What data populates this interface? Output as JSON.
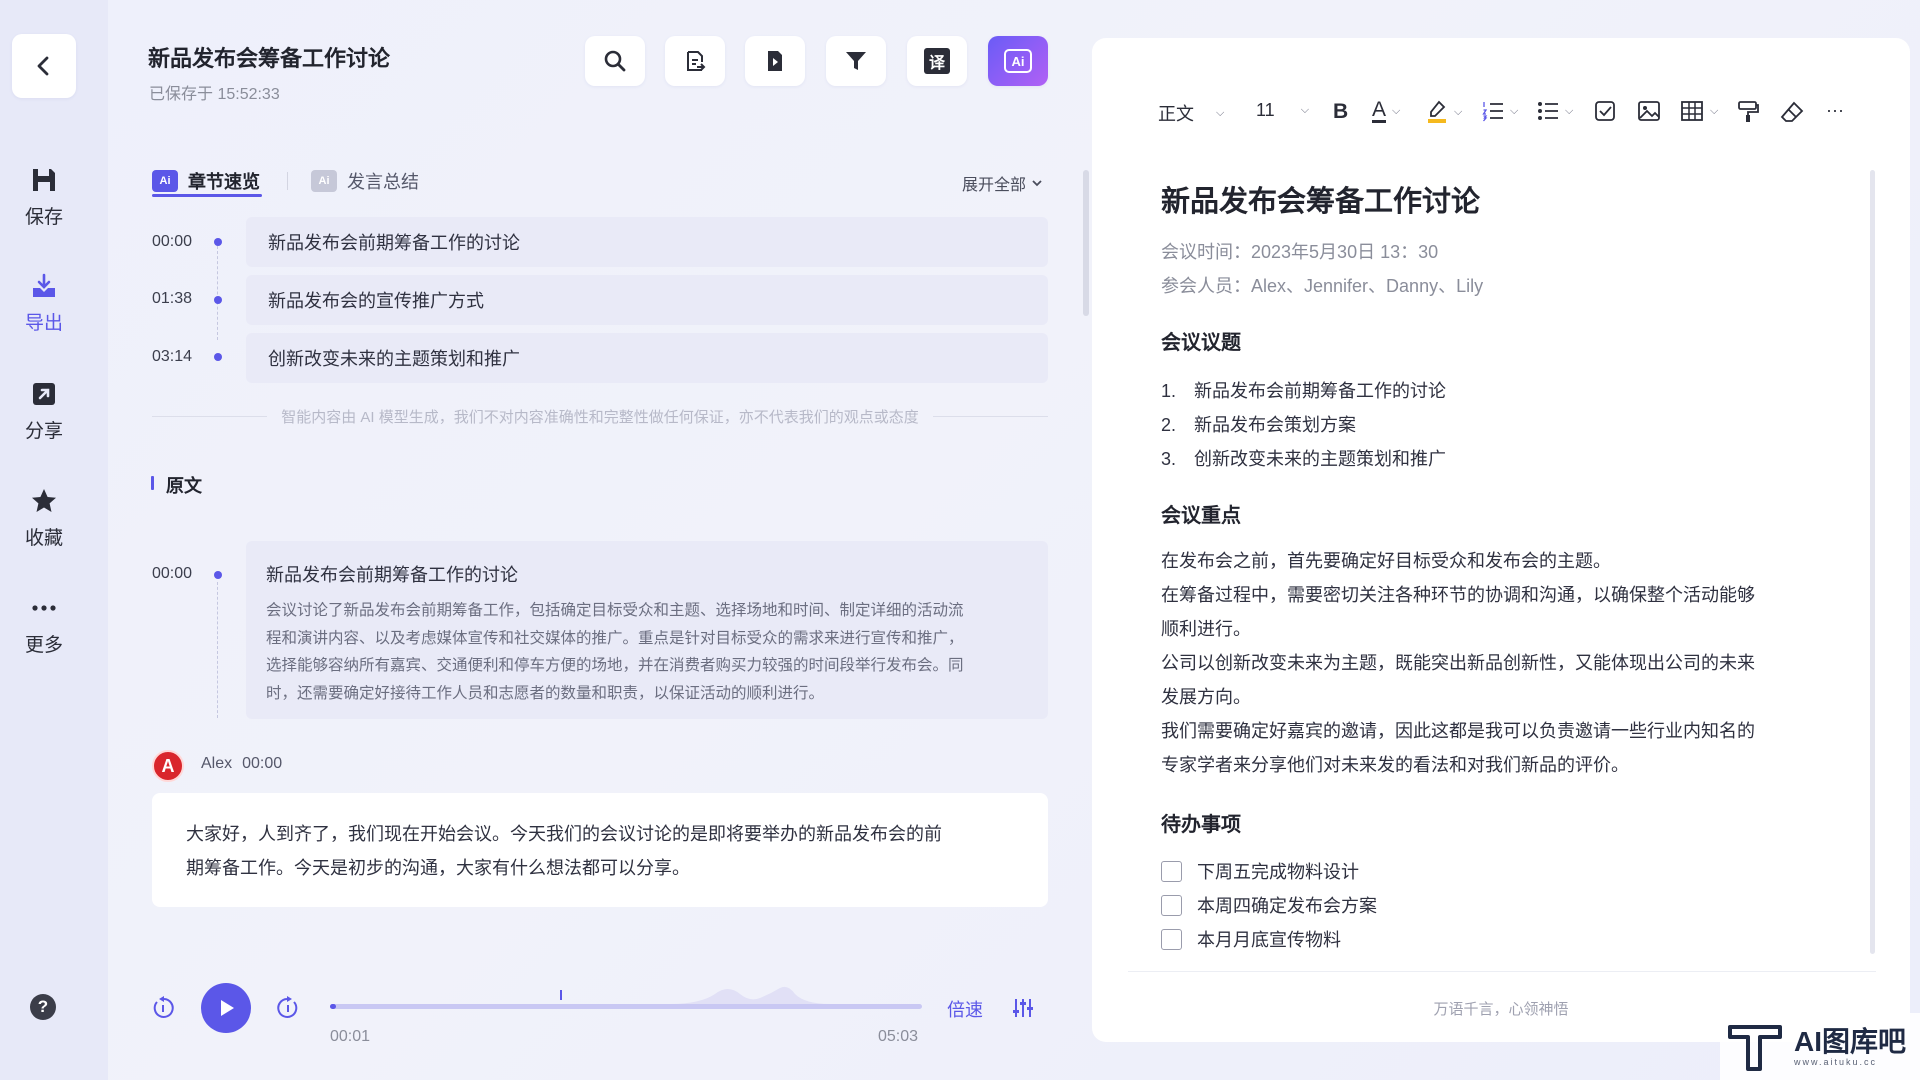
{
  "sidebar": {
    "items": [
      {
        "label": "保存",
        "icon": "save-icon"
      },
      {
        "label": "导出",
        "icon": "export-icon"
      },
      {
        "label": "分享",
        "icon": "share-icon"
      },
      {
        "label": "收藏",
        "icon": "star-icon"
      },
      {
        "label": "更多",
        "icon": "more-icon"
      }
    ],
    "help_label": "?"
  },
  "header": {
    "title": "新品发布会筹备工作讨论",
    "saved": "已保存于 15:52:33",
    "translate_label": "译",
    "ai_label": "Ai"
  },
  "tabs": {
    "chapters": "章节速览",
    "summary": "发言总结",
    "expand": "展开全部",
    "ai_badge": "Ai"
  },
  "chapters": [
    {
      "time": "00:00",
      "title": "新品发布会前期筹备工作的讨论"
    },
    {
      "time": "01:38",
      "title": "新品发布会的宣传推广方式"
    },
    {
      "time": "03:14",
      "title": "创新改变未来的主题策划和推广"
    }
  ],
  "disclaimer": "智能内容由 AI 模型生成，我们不对内容准确性和完整性做任何保证，亦不代表我们的观点或态度",
  "original": {
    "heading": "原文",
    "section": {
      "time": "00:00",
      "title": "新品发布会前期筹备工作的讨论",
      "lines": [
        "会议讨论了新品发布会前期筹备工作，包括确定目标受众和主题、选择场地和时间、制定详细的活动流",
        "程和演讲内容、以及考虑媒体宣传和社交媒体的推广。重点是针对目标受众的需求来进行宣传和推广，",
        "选择能够容纳所有嘉宾、交通便利和停车方便的场地，并在消费者购买力较强的时间段举行发布会。同",
        "时，还需要确定好接待工作人员和志愿者的数量和职责，以保证活动的顺利进行。"
      ]
    },
    "speaker": {
      "initial": "A",
      "name": "Alex",
      "time": "00:00"
    },
    "speech_lines": [
      "大家好，人到齐了，我们现在开始会议。今天我们的会议讨论的是即将要举办的新品发布会的前",
      "期筹备工作。今天是初步的沟通，大家有什么想法都可以分享。"
    ]
  },
  "player": {
    "current": "00:01",
    "total": "05:03",
    "speed": "倍速",
    "progress": 0.003
  },
  "editor": {
    "toolbar": {
      "style": "正文",
      "size": "11",
      "bold": "B",
      "font_color": "A",
      "more": "···"
    },
    "title": "新品发布会筹备工作讨论",
    "meta": [
      "会议时间：2023年5月30日 13：30",
      "参会人员：Alex、Jennifer、Danny、Lily"
    ],
    "agenda_heading": "会议议题",
    "agenda": [
      {
        "n": "1.",
        "text": "新品发布会前期筹备工作的讨论"
      },
      {
        "n": "2.",
        "text": "新品发布会策划方案"
      },
      {
        "n": "3.",
        "text": "创新改变未来的主题策划和推广"
      }
    ],
    "keypoints_heading": "会议重点",
    "keypoints_lines": [
      "在发布会之前，首先要确定好目标受众和发布会的主题。",
      "在筹备过程中，需要密切关注各种环节的协调和沟通，以确保整个活动能够",
      "顺利进行。",
      "公司以创新改变未来为主题，既能突出新品创新性，又能体现出公司的未来",
      "发展方向。",
      "我们需要确定好嘉宾的邀请，因此这都是我可以负责邀请一些行业内知名的",
      "专家学者来分享他们对未来发的看法和对我们新品的评价。"
    ],
    "todo_heading": "待办事项",
    "todos": [
      "下周五完成物料设计",
      "本周四确定发布会方案",
      "本月月底宣传物料"
    ],
    "footer": "万语千言，心领神悟"
  },
  "watermark": {
    "text": "AI图库吧",
    "url": "www.aituku.cc"
  },
  "colors": {
    "accent": "#5b57e8",
    "avatar": "#d9262c"
  }
}
